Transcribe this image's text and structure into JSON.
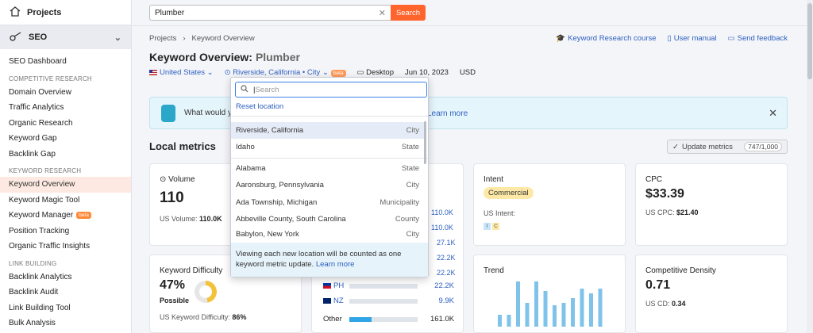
{
  "sidebar": {
    "projects": "Projects",
    "seo": "SEO",
    "dashboard": "SEO Dashboard",
    "sec1": "COMPETITIVE RESEARCH",
    "comp": [
      "Domain Overview",
      "Traffic Analytics",
      "Organic Research",
      "Keyword Gap",
      "Backlink Gap"
    ],
    "sec2": "KEYWORD RESEARCH",
    "kw": [
      "Keyword Overview",
      "Keyword Magic Tool",
      "Keyword Manager",
      "Position Tracking",
      "Organic Traffic Insights"
    ],
    "beta": "beta",
    "sec3": "LINK BUILDING",
    "lb": [
      "Backlink Analytics",
      "Backlink Audit",
      "Link Building Tool",
      "Bulk Analysis"
    ]
  },
  "search": {
    "value": "Plumber",
    "button": "Search"
  },
  "breadcrumb": {
    "root": "Projects",
    "current": "Keyword Overview"
  },
  "links": {
    "course": "Keyword Research course",
    "manual": "User manual",
    "feedback": "Send feedback"
  },
  "title": {
    "label": "Keyword Overview:",
    "keyword": "Plumber"
  },
  "filters": {
    "country": "United States",
    "location": "Riverside, California • City",
    "beta": "beta",
    "device": "Desktop",
    "date": "Jun 10, 2023",
    "currency": "USD"
  },
  "banner": {
    "text": "What would y",
    "link": "Learn more"
  },
  "local": {
    "title": "Local metrics",
    "update": "Update metrics",
    "count": "747/1,000"
  },
  "volume": {
    "label": "Volume",
    "value": "110",
    "sub_label": "US Volume:",
    "sub_value": "110.0K"
  },
  "kd": {
    "label": "Keyword Difficulty",
    "value": "47%",
    "level": "Possible",
    "percent": 47,
    "sub_label": "US Keyword Difficulty:",
    "sub_value": "86%"
  },
  "intent": {
    "label": "Intent",
    "value": "Commercial",
    "sub_label": "US Intent:",
    "tag1": "I",
    "tag2": "C"
  },
  "cpc": {
    "label": "CPC",
    "value": "$33.39",
    "sub_label": "US CPC:",
    "sub_value": "$21.40"
  },
  "trend": {
    "label": "Trend",
    "values": [
      0.25,
      0.25,
      0.95,
      0.5,
      0.95,
      0.75,
      0.45,
      0.5,
      0.6,
      0.8,
      0.7,
      0.8
    ]
  },
  "density": {
    "label": "Competitive Density",
    "value": "0.71",
    "sub_label": "US CD:",
    "sub_value": "0.34"
  },
  "countries": {
    "hidden_values": [
      "110.0K",
      "110.0K",
      "27.1K",
      "22.2K",
      "22.2K"
    ],
    "rows": [
      {
        "code": "PH",
        "value": "22.2K",
        "share": 0.0
      },
      {
        "code": "NZ",
        "value": "9.9K",
        "share": 0.0
      },
      {
        "code": "Other",
        "value": "161.0K",
        "share": 0.33
      }
    ]
  },
  "dropdown": {
    "placeholder": "Search",
    "reset": "Reset location",
    "items": [
      {
        "name": "Riverside, California",
        "type": "City"
      },
      {
        "name": "Idaho",
        "type": "State"
      },
      {
        "name": "Alabama",
        "type": "State"
      },
      {
        "name": "Aaronsburg, Pennsylvania",
        "type": "City"
      },
      {
        "name": "Ada Township, Michigan",
        "type": "Municipality"
      },
      {
        "name": "Abbeville County, South Carolina",
        "type": "County"
      },
      {
        "name": "Babylon, New York",
        "type": "City"
      }
    ],
    "footer": "Viewing each new location will be counted as one keyword metric update.",
    "footer_link": "Learn more"
  },
  "colors": {
    "accent": "#ff642d",
    "link": "#2d5fbf",
    "bar": "#30a6e6",
    "trend": "#7fc3ea"
  }
}
